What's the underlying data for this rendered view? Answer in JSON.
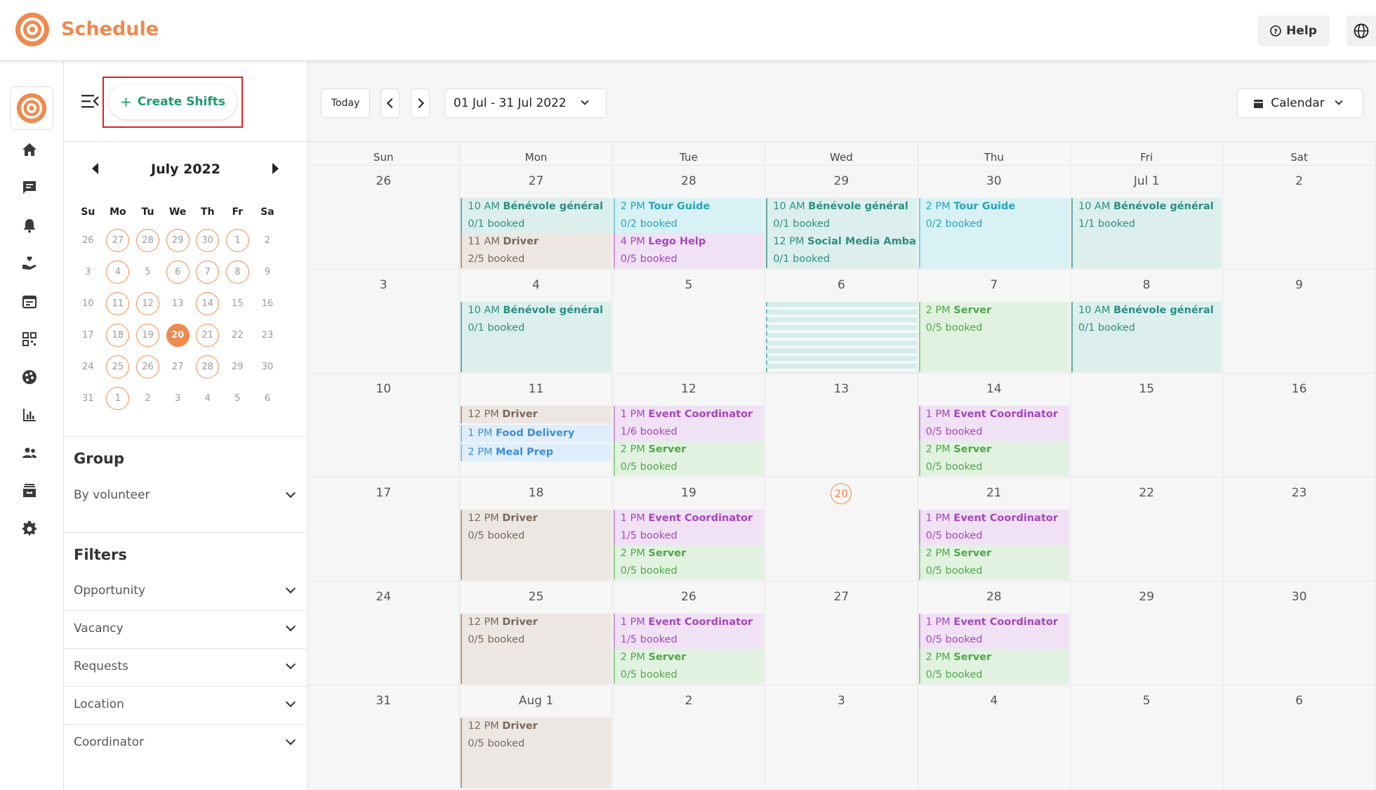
{
  "app": {
    "title": "Schedule",
    "help_label": "Help"
  },
  "sidebar": {
    "create_label": "Create Shifts",
    "mini_calendar": {
      "title": "July 2022",
      "dow": [
        "Su",
        "Mo",
        "Tu",
        "We",
        "Th",
        "Fr",
        "Sa"
      ],
      "weeks": [
        [
          "26",
          "27",
          "28",
          "29",
          "30",
          "1",
          "2"
        ],
        [
          "3",
          "4",
          "5",
          "6",
          "7",
          "8",
          "9"
        ],
        [
          "10",
          "11",
          "12",
          "13",
          "14",
          "15",
          "16"
        ],
        [
          "17",
          "18",
          "19",
          "20",
          "21",
          "22",
          "23"
        ],
        [
          "24",
          "25",
          "26",
          "27",
          "28",
          "29",
          "30"
        ],
        [
          "31",
          "1",
          "2",
          "3",
          "4",
          "5",
          "6"
        ]
      ],
      "circled": [
        [
          false,
          true,
          true,
          true,
          true,
          true,
          false
        ],
        [
          false,
          true,
          false,
          true,
          true,
          true,
          false
        ],
        [
          false,
          true,
          true,
          false,
          true,
          false,
          false
        ],
        [
          false,
          true,
          true,
          false,
          true,
          false,
          false
        ],
        [
          false,
          true,
          true,
          false,
          true,
          false,
          false
        ],
        [
          false,
          true,
          false,
          false,
          false,
          false,
          false
        ]
      ],
      "selected_day": "20"
    },
    "group": {
      "title": "Group",
      "value": "By volunteer"
    },
    "filters": {
      "title": "Filters",
      "items": [
        "Opportunity",
        "Vacancy",
        "Requests",
        "Location",
        "Coordinator"
      ]
    }
  },
  "toolbar": {
    "today_label": "Today",
    "date_range": "01 Jul - 31 Jul 2022",
    "view_label": "Calendar"
  },
  "calendar": {
    "weekdays": [
      "Sun",
      "Mon",
      "Tue",
      "Wed",
      "Thu",
      "Fri",
      "Sat"
    ],
    "today_label": "20",
    "weeks": [
      {
        "days": [
          "26",
          "27",
          "28",
          "29",
          "30",
          "Jul 1",
          "2"
        ]
      },
      {
        "days": [
          "3",
          "4",
          "5",
          "6",
          "7",
          "8",
          "9"
        ]
      },
      {
        "days": [
          "10",
          "11",
          "12",
          "13",
          "14",
          "15",
          "16"
        ]
      },
      {
        "days": [
          "17",
          "18",
          "19",
          "20",
          "21",
          "22",
          "23"
        ]
      },
      {
        "days": [
          "24",
          "25",
          "26",
          "27",
          "28",
          "29",
          "30"
        ]
      },
      {
        "days": [
          "31",
          "Aug 1",
          "2",
          "3",
          "4",
          "5",
          "6"
        ]
      }
    ],
    "events": [
      {
        "week": 0,
        "day": 1,
        "slot": 0,
        "height": 2,
        "kind": "teal",
        "time": "10 AM",
        "title": "Bénévole général",
        "booked": "0/1 booked"
      },
      {
        "week": 0,
        "day": 1,
        "slot": 2,
        "height": 2,
        "kind": "brown",
        "time": "11 AM",
        "title": "Driver",
        "booked": "2/5 booked"
      },
      {
        "week": 0,
        "day": 2,
        "slot": 0,
        "height": 2,
        "kind": "cyan",
        "time": "2 PM",
        "title": "Tour Guide",
        "booked": "0/2 booked"
      },
      {
        "week": 0,
        "day": 2,
        "slot": 2,
        "height": 2,
        "kind": "purple",
        "time": "4 PM",
        "title": "Lego Help",
        "booked": "0/5 booked"
      },
      {
        "week": 0,
        "day": 3,
        "slot": 0,
        "height": 2,
        "kind": "teal",
        "time": "10 AM",
        "title": "Bénévole général",
        "booked": "0/1 booked"
      },
      {
        "week": 0,
        "day": 3,
        "slot": 2,
        "height": 2,
        "kind": "teal",
        "time": "12 PM",
        "title": "Social Media Ambas:",
        "booked": "0/1 booked"
      },
      {
        "week": 0,
        "day": 4,
        "slot": 0,
        "height": 4,
        "kind": "cyan",
        "time": "2 PM",
        "title": "Tour Guide",
        "booked": "0/2 booked"
      },
      {
        "week": 0,
        "day": 5,
        "slot": 0,
        "height": 4,
        "kind": "teal",
        "time": "10 AM",
        "title": "Bénévole général",
        "booked": "1/1 booked"
      },
      {
        "week": 1,
        "day": 1,
        "slot": 0,
        "height": 4,
        "kind": "teal",
        "time": "10 AM",
        "title": "Bénévole général",
        "booked": "0/1 booked"
      },
      {
        "week": 1,
        "day": 4,
        "slot": 0,
        "height": 4,
        "kind": "green",
        "time": "2 PM",
        "title": "Server",
        "booked": "0/5 booked"
      },
      {
        "week": 1,
        "day": 5,
        "slot": 0,
        "height": 4,
        "kind": "teal",
        "time": "10 AM",
        "title": "Bénévole général",
        "booked": "0/1 booked"
      },
      {
        "week": 2,
        "day": 1,
        "slot": 0,
        "height": 1,
        "kind": "brown",
        "time": "12 PM",
        "title": "Driver",
        "booked": ""
      },
      {
        "week": 2,
        "day": 1,
        "slot": 1,
        "height": 1,
        "kind": "blue",
        "time": "1 PM",
        "title": "Food Delivery",
        "booked": ""
      },
      {
        "week": 2,
        "day": 1,
        "slot": 2,
        "height": 1,
        "kind": "blue",
        "time": "2 PM",
        "title": "Meal Prep",
        "booked": ""
      },
      {
        "week": 2,
        "day": 2,
        "slot": 0,
        "height": 2,
        "kind": "purple",
        "time": "1 PM",
        "title": "Event Coordinator",
        "booked": "1/6 booked"
      },
      {
        "week": 2,
        "day": 2,
        "slot": 2,
        "height": 2,
        "kind": "green",
        "time": "2 PM",
        "title": "Server",
        "booked": "0/5 booked"
      },
      {
        "week": 2,
        "day": 4,
        "slot": 0,
        "height": 2,
        "kind": "purple",
        "time": "1 PM",
        "title": "Event Coordinator",
        "booked": "0/5 booked"
      },
      {
        "week": 2,
        "day": 4,
        "slot": 2,
        "height": 2,
        "kind": "green",
        "time": "2 PM",
        "title": "Server",
        "booked": "0/5 booked"
      },
      {
        "week": 3,
        "day": 1,
        "slot": 0,
        "height": 4,
        "kind": "brown",
        "time": "12 PM",
        "title": "Driver",
        "booked": "0/5 booked"
      },
      {
        "week": 3,
        "day": 2,
        "slot": 0,
        "height": 2,
        "kind": "purple",
        "time": "1 PM",
        "title": "Event Coordinator",
        "booked": "1/5 booked"
      },
      {
        "week": 3,
        "day": 2,
        "slot": 2,
        "height": 2,
        "kind": "green",
        "time": "2 PM",
        "title": "Server",
        "booked": "0/5 booked"
      },
      {
        "week": 3,
        "day": 4,
        "slot": 0,
        "height": 2,
        "kind": "purple",
        "time": "1 PM",
        "title": "Event Coordinator",
        "booked": "0/5 booked"
      },
      {
        "week": 3,
        "day": 4,
        "slot": 2,
        "height": 2,
        "kind": "green",
        "time": "2 PM",
        "title": "Server",
        "booked": "0/5 booked"
      },
      {
        "week": 4,
        "day": 1,
        "slot": 0,
        "height": 4,
        "kind": "brown",
        "time": "12 PM",
        "title": "Driver",
        "booked": "0/5 booked"
      },
      {
        "week": 4,
        "day": 2,
        "slot": 0,
        "height": 2,
        "kind": "purple",
        "time": "1 PM",
        "title": "Event Coordinator",
        "booked": "1/5 booked"
      },
      {
        "week": 4,
        "day": 2,
        "slot": 2,
        "height": 2,
        "kind": "green",
        "time": "2 PM",
        "title": "Server",
        "booked": "0/5 booked"
      },
      {
        "week": 4,
        "day": 4,
        "slot": 0,
        "height": 2,
        "kind": "purple",
        "time": "1 PM",
        "title": "Event Coordinator",
        "booked": "0/5 booked"
      },
      {
        "week": 4,
        "day": 4,
        "slot": 2,
        "height": 2,
        "kind": "green",
        "time": "2 PM",
        "title": "Server",
        "booked": "0/5 booked"
      },
      {
        "week": 5,
        "day": 1,
        "slot": 0,
        "height": 4,
        "kind": "brown",
        "time": "12 PM",
        "title": "Driver",
        "booked": "0/5 booked"
      }
    ],
    "kinds": {
      "teal": {
        "bg": "#dcefed",
        "border": "#5eaaa1",
        "text": "#2e8d83"
      },
      "cyan": {
        "bg": "#d8f1f5",
        "border": "#7bcfdc",
        "text": "#28a4b8"
      },
      "brown": {
        "bg": "#ede7e3",
        "border": "#b09a8c",
        "text": "#7c665a"
      },
      "purple": {
        "bg": "#f1e1f5",
        "border": "#c993d6",
        "text": "#a347ba"
      },
      "green": {
        "bg": "#e2f2e1",
        "border": "#8fcf8b",
        "text": "#4fa64a"
      },
      "blue": {
        "bg": "#e0eefb",
        "border": "#8ebde8",
        "text": "#3d8fd6"
      }
    },
    "striped_cells": [
      {
        "week": 1,
        "day": 3
      }
    ]
  },
  "colors": {
    "accent": "#ee8a4e",
    "create": "#1f9b70"
  }
}
